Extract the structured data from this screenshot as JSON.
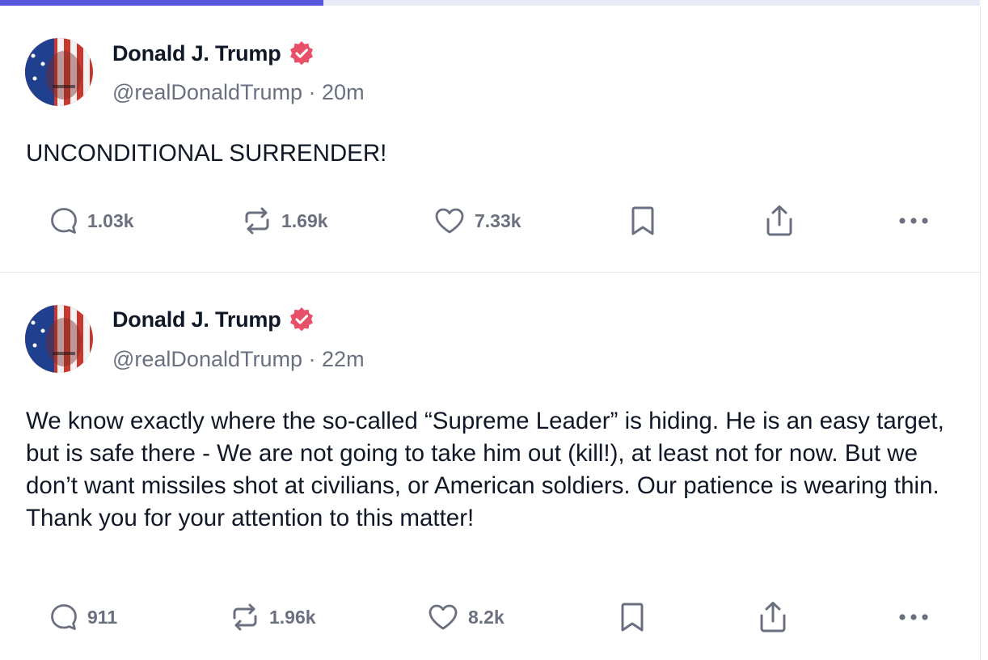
{
  "progress": {
    "fraction": 0.33
  },
  "posts": [
    {
      "author": {
        "name": "Donald J. Trump",
        "handle": "@realDonaldTrump",
        "separator": "·",
        "time": "20m",
        "verified": true
      },
      "text": "UNCONDITIONAL SURRENDER!",
      "stats": {
        "replies": "1.03k",
        "reposts": "1.69k",
        "likes": "7.33k"
      }
    },
    {
      "author": {
        "name": "Donald J. Trump",
        "handle": "@realDonaldTrump",
        "separator": "·",
        "time": "22m",
        "verified": true
      },
      "text": "We know exactly where the so-called “Supreme Leader” is hiding. He is an easy target, but is safe there - We are not going to take him out (kill!), at least not for now. But we don’t want missiles shot at civilians, or American soldiers. Our patience is wearing thin. Thank you for your attention to this matter!",
      "stats": {
        "replies": "911",
        "reposts": "1.96k",
        "likes": "8.2k"
      }
    }
  ],
  "colors": {
    "progress": "#5755d9",
    "track": "#e6ebf7",
    "verified": "#e8506a",
    "muted": "#6b7080",
    "text": "#101827"
  },
  "icons": [
    "comment-icon",
    "repost-icon",
    "heart-icon",
    "bookmark-icon",
    "share-icon",
    "more-icon",
    "verified-badge-icon"
  ]
}
